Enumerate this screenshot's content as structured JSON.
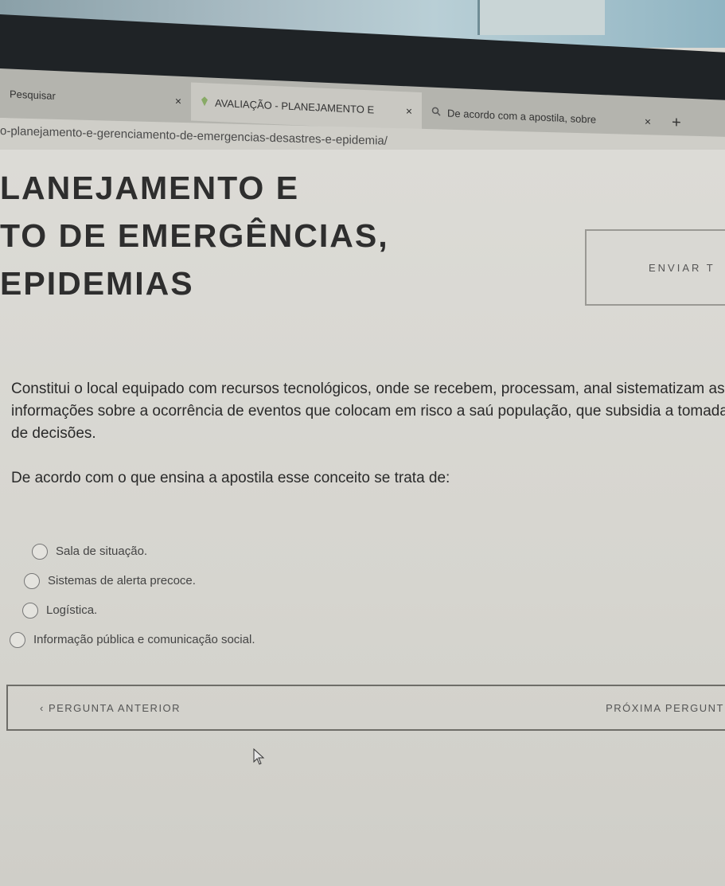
{
  "browser": {
    "tabs": [
      {
        "label": "Pesquisar",
        "close": "×"
      },
      {
        "label": "AVALIAÇÃO - PLANEJAMENTO E",
        "close": "×"
      },
      {
        "label": "De acordo com a apostila, sobre",
        "close": "×"
      }
    ],
    "new_tab": "+",
    "address": "o-planejamento-e-gerenciamento-de-emergencias-desastres-e-epidemia/"
  },
  "page": {
    "title_lines": [
      "LANEJAMENTO E",
      "TO DE EMERGÊNCIAS,",
      "EPIDEMIAS"
    ],
    "send_button": "ENVIAR T",
    "question": "Constitui o local equipado com recursos tecnológicos, onde se recebem, processam, anal sistematizam as informações sobre a ocorrência de eventos que colocam em risco a saú população, que subsidia a tomada de decisões.",
    "prompt": "De acordo com o que ensina a apostila esse conceito se trata de:",
    "options": [
      "Sala de situação.",
      "Sistemas de alerta precoce.",
      "Logística.",
      "Informação pública e comunicação social."
    ],
    "prev_button": "‹ PERGUNTA ANTERIOR",
    "next_button": "PRÓXIMA PERGUNT"
  }
}
